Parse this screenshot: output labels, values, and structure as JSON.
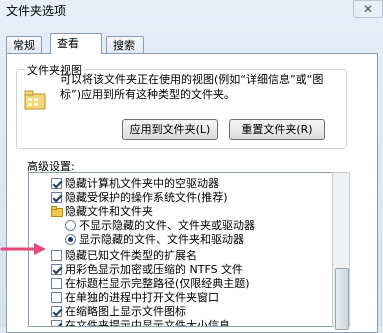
{
  "window": {
    "title": "文件夹选项",
    "close_glyph": "✕"
  },
  "tabs": [
    {
      "label": "常规"
    },
    {
      "label": "查看"
    },
    {
      "label": "搜索"
    }
  ],
  "folder_views": {
    "legend": "文件夹视图",
    "description": "可以将该文件夹正在使用的视图(例如“详细信息”或“图标”)应用到所有这种类型的文件夹。",
    "apply_button": "应用到文件夹(L)",
    "reset_button": "重置文件夹(R)"
  },
  "advanced": {
    "label": "高级设置:",
    "items": [
      {
        "text": "隐藏计算机文件夹中的空驱动器",
        "control": "checkbox",
        "checked": true
      },
      {
        "text": "隐藏受保护的操作系统文件(推荐)",
        "control": "checkbox",
        "checked": true
      },
      {
        "text": "隐藏文件和文件夹",
        "control": "folder",
        "checked": false
      },
      {
        "text": "不显示隐藏的文件、文件夹或驱动器",
        "control": "radio",
        "checked": false
      },
      {
        "text": "显示隐藏的文件、文件夹和驱动器",
        "control": "radio",
        "checked": true
      },
      {
        "text": "隐藏已知文件类型的扩展名",
        "control": "checkbox",
        "checked": false
      },
      {
        "text": "用彩色显示加密或压缩的 NTFS 文件",
        "control": "checkbox",
        "checked": true
      },
      {
        "text": "在标题栏显示完整路径(仅限经典主题)",
        "control": "checkbox",
        "checked": false
      },
      {
        "text": "在单独的进程中打开文件夹窗口",
        "control": "checkbox",
        "checked": false
      },
      {
        "text": "在缩略图上显示文件图标",
        "control": "checkbox",
        "checked": true
      },
      {
        "text": "在文件夹提示中显示文件大小信息",
        "control": "checkbox",
        "checked": true
      }
    ]
  },
  "colors": {
    "arrow": "#e8477a",
    "check": "#1e3a73",
    "border": "#8a9bb3"
  }
}
